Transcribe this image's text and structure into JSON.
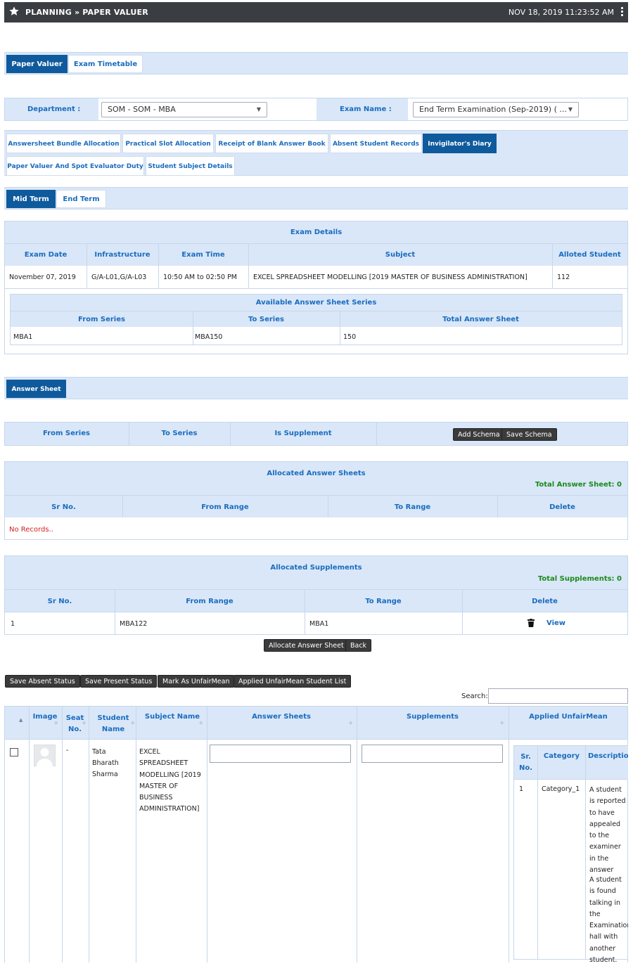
{
  "header": {
    "title": "PLANNING » PAPER VALUER",
    "datetime": "NOV 18, 2019  11:23:52 AM"
  },
  "main_tabs": [
    {
      "label": "Paper Valuer"
    },
    {
      "label": "Exam Timetable"
    }
  ],
  "filters": {
    "department_label": "Department :",
    "department_value": "SOM - SOM - MBA",
    "exam_label": "Exam Name :",
    "exam_value": "End Term Examination (Sep-2019) ( ..."
  },
  "sub_tabs": [
    {
      "label": "Answersheet Bundle Allocation"
    },
    {
      "label": "Practical Slot Allocation"
    },
    {
      "label": "Receipt of Blank Answer Book"
    },
    {
      "label": "Absent Student Records"
    },
    {
      "label": "Invigilator's Diary"
    },
    {
      "label": "Paper Valuer And Spot Evaluator Duty"
    },
    {
      "label": "Student Subject Details"
    }
  ],
  "term_tabs": [
    {
      "label": "Mid Term"
    },
    {
      "label": "End Term"
    }
  ],
  "exam_details": {
    "title": "Exam Details",
    "headers": [
      "Exam Date",
      "Infrastructure",
      "Exam Time",
      "Subject",
      "Alloted Student"
    ],
    "row": [
      "November 07, 2019",
      "G/A-L01,G/A-L03",
      "10:50 AM to 02:50 PM",
      "EXCEL SPREADSHEET MODELLING [2019 MASTER OF BUSINESS ADMINISTRATION]",
      "112"
    ]
  },
  "available_series": {
    "title": "Available Answer Sheet Series",
    "headers": [
      "From Series",
      "To Series",
      "Total Answer Sheet"
    ],
    "row": [
      "MBA1",
      "MBA150",
      "150"
    ]
  },
  "answer_sheet_tab": "Answer Sheet",
  "schema": {
    "headers": [
      "From Series",
      "To Series",
      "Is Supplement"
    ],
    "add_label": "Add Schema",
    "save_label": "Save Schema"
  },
  "allocated_sheets": {
    "title": "Allocated Answer Sheets",
    "total": "Total Answer Sheet: 0",
    "headers": [
      "Sr No.",
      "From Range",
      "To Range",
      "Delete"
    ],
    "empty": "No Records.."
  },
  "allocated_supplements": {
    "title": "Allocated Supplements",
    "total": "Total Supplements: 0",
    "headers": [
      "Sr No.",
      "From Range",
      "To Range",
      "Delete"
    ],
    "row": [
      "1",
      "MBA122",
      "MBA1",
      "View"
    ]
  },
  "actions": {
    "allocate": "Allocate Answer Sheet",
    "back": "Back"
  },
  "status_buttons": [
    "Save Absent Status",
    "Save Present Status",
    "Mark As UnfairMean",
    "Applied UnfairMean Student List"
  ],
  "search_label": "Search:",
  "student_table": {
    "headers": [
      "Image",
      "Seat No.",
      "Student Name",
      "Subject Name",
      "Answer Sheets",
      "Supplements",
      "Applied UnfairMean"
    ],
    "row": {
      "seat": "-",
      "name": "Tata Bharath Sharma",
      "subject": "EXCEL SPREADSHEET MODELLING [2019 MASTER OF BUSINESS ADMINISTRATION]"
    },
    "unfair": {
      "headers": [
        "Sr. No.",
        "Category",
        "Description"
      ],
      "sr": "1",
      "category": "Category_1",
      "desc1": "A student is reported to have appealed to the examiner in the answer",
      "desc2": "A student is found talking in the Examination hall with another student."
    }
  }
}
